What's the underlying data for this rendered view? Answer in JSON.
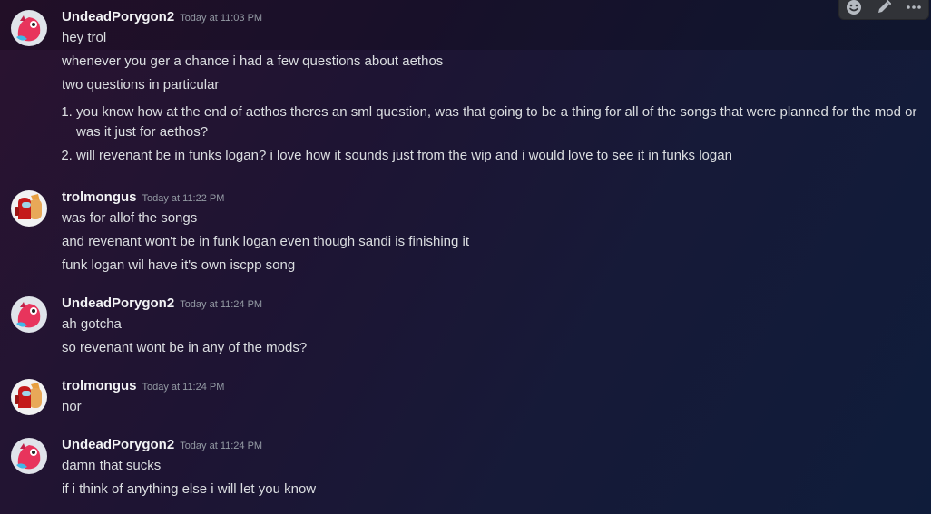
{
  "toolbar": {
    "icons": [
      "add-reaction-icon",
      "edit-icon",
      "more-icon"
    ]
  },
  "messages": [
    {
      "user": "UndeadPorygon2",
      "timestamp": "Today at 11:03 PM",
      "lines": [
        "hey trol",
        "whenever you ger a chance i had a few questions about aethos",
        "two questions in particular"
      ],
      "list": [
        "you know how at the end of aethos theres an sml question, was that going to be a thing for all of the songs that were planned for the mod or was it just for aethos?",
        "will revenant be in funks logan? i love how it sounds just from the wip and i would love to see it in funks logan"
      ]
    },
    {
      "user": "trolmongus",
      "timestamp": "Today at 11:22 PM",
      "lines": [
        "was for allof the songs",
        "and revenant won't be in funk logan even though sandi is finishing it",
        "funk logan  wil have it's own iscpp song"
      ]
    },
    {
      "user": "UndeadPorygon2",
      "timestamp": "Today at 11:24 PM",
      "lines": [
        "ah gotcha",
        "so revenant wont be in any of the mods?"
      ]
    },
    {
      "user": "trolmongus",
      "timestamp": "Today at 11:24 PM",
      "lines": [
        "nor"
      ]
    },
    {
      "user": "UndeadPorygon2",
      "timestamp": "Today at 11:24 PM",
      "lines": [
        "damn that sucks",
        "if i think of anything else i will let you know"
      ]
    }
  ]
}
